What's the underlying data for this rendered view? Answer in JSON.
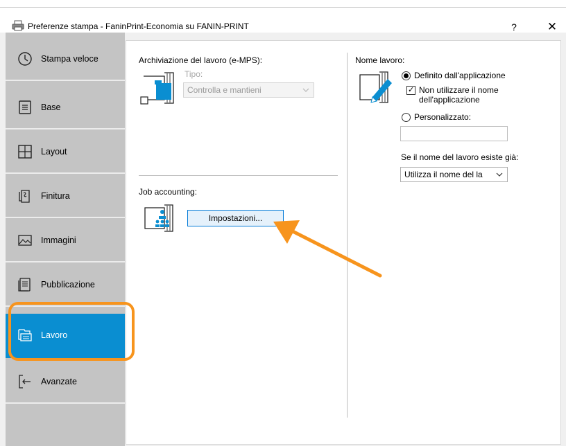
{
  "window": {
    "title": "Preferenze stampa - FaninPrint-Economia su FANIN-PRINT",
    "help_label": "?",
    "close_label": "✕"
  },
  "sidebar": {
    "items": [
      {
        "label": "Stampa veloce",
        "icon": "clock-icon"
      },
      {
        "label": "Base",
        "icon": "document-icon"
      },
      {
        "label": "Layout",
        "icon": "grid-icon"
      },
      {
        "label": "Finitura",
        "icon": "staple-icon"
      },
      {
        "label": "Immagini",
        "icon": "image-icon"
      },
      {
        "label": "Pubblicazione",
        "icon": "booklet-icon"
      },
      {
        "label": "Lavoro",
        "icon": "job-stack-icon",
        "active": true
      },
      {
        "label": "Avanzate",
        "icon": "advanced-arrow-icon"
      }
    ]
  },
  "job_storage": {
    "heading": "Archiviazione del lavoro (e-MPS):",
    "type_label": "Tipo:",
    "type_value": "Controlla e mantieni"
  },
  "job_accounting": {
    "heading": "Job accounting:",
    "settings_button": "Impostazioni..."
  },
  "job_name": {
    "heading": "Nome lavoro:",
    "radio_app_defined": "Definito dall'applicazione",
    "radio_app_defined_checked": true,
    "checkbox_label_line1": "Non utilizzare il nome",
    "checkbox_label_line2": "dell'applicazione",
    "checkbox_checked": true,
    "radio_custom": "Personalizzato:",
    "custom_value": "",
    "exists_label": "Se il nome del lavoro esiste già:",
    "exists_value": "Utilizza il nome del la"
  },
  "colors": {
    "accent": "#0a8ed1",
    "highlight": "#f7941d",
    "sidebar": "#c4c4c4"
  }
}
